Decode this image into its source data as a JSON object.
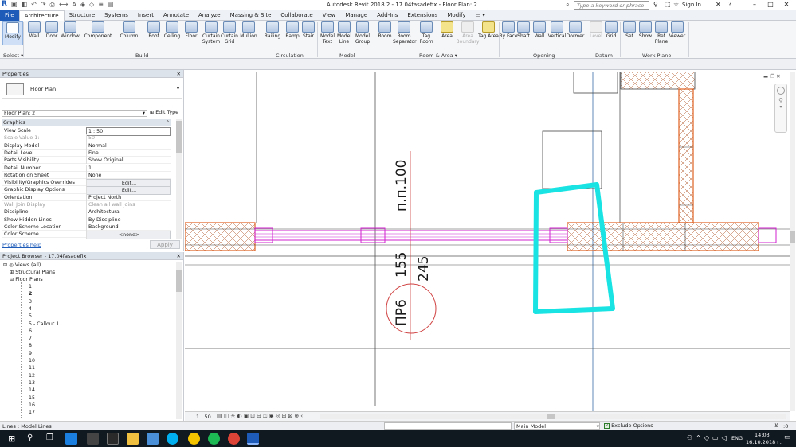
{
  "title_bar": {
    "title": "Autodesk Revit 2018.2 -    17.04fasadefix - Floor Plan: 2",
    "search_placeholder": "Type a keyword or phrase",
    "sign_in": "Sign In"
  },
  "tabs": [
    "File",
    "Architecture",
    "Structure",
    "Systems",
    "Insert",
    "Annotate",
    "Analyze",
    "Massing & Site",
    "Collaborate",
    "View",
    "Manage",
    "Add-Ins",
    "Extensions",
    "Modify"
  ],
  "active_tab": "Architecture",
  "ribbon": {
    "modify": "Modify",
    "select": "Select ▾",
    "build_label": "Build",
    "build": [
      "Wall",
      "Door",
      "Window",
      "Component",
      "Column",
      "Roof",
      "Ceiling",
      "Floor",
      "Curtain System",
      "Curtain Grid",
      "Mullion"
    ],
    "circulation_label": "Circulation",
    "circulation": [
      "Railing",
      "Ramp",
      "Stair"
    ],
    "model_label": "Model",
    "model": [
      "Model Text",
      "Model Line",
      "Model Group"
    ],
    "room_label": "Room & Area ▾",
    "room": [
      "Room",
      "Room Separator",
      "Tag Room",
      "Area",
      "Area Boundary",
      "Tag Area"
    ],
    "opening_label": "Opening",
    "opening": [
      "By Face",
      "Shaft",
      "Wall",
      "Vertical",
      "Dormer"
    ],
    "datum_label": "Datum",
    "datum": [
      "Level",
      "Grid"
    ],
    "workplane_label": "Work Plane",
    "workplane": [
      "Set",
      "Show",
      "Ref Plane",
      "Viewer"
    ]
  },
  "properties": {
    "title": "Properties",
    "type_name": "Floor Plan",
    "instance": "Floor Plan: 2",
    "edit_type": "Edit Type",
    "section": "Graphics",
    "rows": [
      {
        "k": "View Scale",
        "v": "1 : 50"
      },
      {
        "k": "Scale Value    1:",
        "v": "50"
      },
      {
        "k": "Display Model",
        "v": "Normal"
      },
      {
        "k": "Detail Level",
        "v": "Fine"
      },
      {
        "k": "Parts Visibility",
        "v": "Show Original"
      },
      {
        "k": "Detail Number",
        "v": "1"
      },
      {
        "k": "Rotation on Sheet",
        "v": "None"
      },
      {
        "k": "Visibility/Graphics Overrides",
        "v": "Edit..."
      },
      {
        "k": "Graphic Display Options",
        "v": "Edit..."
      },
      {
        "k": "Orientation",
        "v": "Project North"
      },
      {
        "k": "Wall Join Display",
        "v": "Clean all wall joins"
      },
      {
        "k": "Discipline",
        "v": "Architectural"
      },
      {
        "k": "Show Hidden Lines",
        "v": "By Discipline"
      },
      {
        "k": "Color Scheme Location",
        "v": "Background"
      },
      {
        "k": "Color Scheme",
        "v": "<none>"
      }
    ],
    "help": "Properties help",
    "apply": "Apply"
  },
  "browser": {
    "title": "Project Browser - 17.04fasadefix",
    "views": "Views (all)",
    "structural": "Structural Plans",
    "floor": "Floor Plans",
    "items": [
      "1",
      "2",
      "3",
      "4",
      "5",
      "5 - Callout 1",
      "6",
      "7",
      "8",
      "9",
      "10",
      "11",
      "12",
      "13",
      "14",
      "15",
      "16",
      "17"
    ]
  },
  "drawing": {
    "label_level": "п.п.100",
    "label_155": "155",
    "label_245": "245",
    "tag": "ПР6",
    "highlight_color": "#19e3e3",
    "wall_color": "#e06020",
    "window_color": "#d020d0"
  },
  "view_scale": "1 : 50",
  "status": {
    "left": "Lines : Model Lines",
    "model": "Main Model",
    "exclude": "Exclude Options",
    "zoom": ":0"
  },
  "taskbar": {
    "time": "14:03",
    "date": "16.10.2018 г.",
    "lang": "ENG"
  }
}
